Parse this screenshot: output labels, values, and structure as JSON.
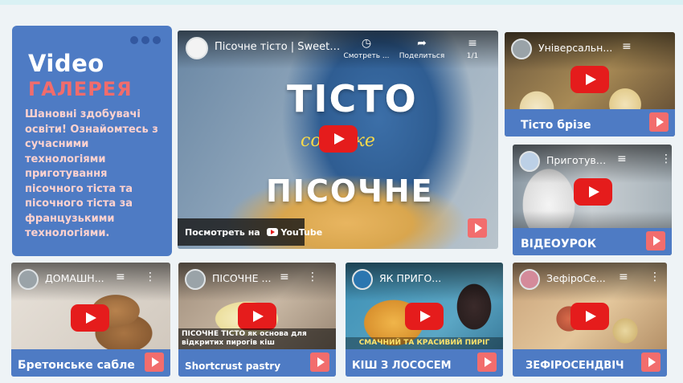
{
  "intro": {
    "title": "Video",
    "subtitle": "ГАЛЕРЕЯ",
    "text": "Шановні здобувачі освіти! Ознайомтесь з сучасними технологіями приготування пісочного тіста та пісочного тіста за французькими технологіями."
  },
  "main_video": {
    "title": "Пісочне тісто | Sweet sh...",
    "watch_later": "Смотреть ...",
    "share": "Поделиться",
    "playlist_count": "1/1",
    "overlay_line1": "ТІСТО",
    "overlay_line2": "солодке",
    "overlay_line3": "ПІСОЧНЕ",
    "watch_on": "Посмотреть на",
    "youtube": "YouTube"
  },
  "videos": [
    {
      "title": "Універсальн...",
      "caption": "Тісто брізе"
    },
    {
      "title": "Приготува...",
      "caption": "ВІДЕОУРОК"
    },
    {
      "title": "ДОМАШН...",
      "caption": "Бретонське сабле"
    },
    {
      "title": "ПІСОЧНЕ ...",
      "overlay": "ПІСОЧНЕ ТІСТО як основа для відкритих пирогів кіш",
      "caption": "Shortcrust pastry"
    },
    {
      "title": "ЯК ПРИГО...",
      "overlay": "СМАЧНИЙ ТА КРАСИВИЙ ПИРІГ",
      "caption": "КІШ З ЛОСОСЕМ"
    },
    {
      "title": "ЗефіроСе...",
      "caption": "ЗЕФІРОСЕНДВІЧ"
    }
  ],
  "icons": {
    "play": "youtube-play-icon",
    "queue": "queue-icon",
    "more": "more-vert-icon",
    "clock": "clock-icon",
    "share": "share-icon"
  },
  "colors": {
    "card_blue": "#4e7bc4",
    "accent_red": "#f26d6d",
    "youtube_red": "#e51c1c"
  }
}
